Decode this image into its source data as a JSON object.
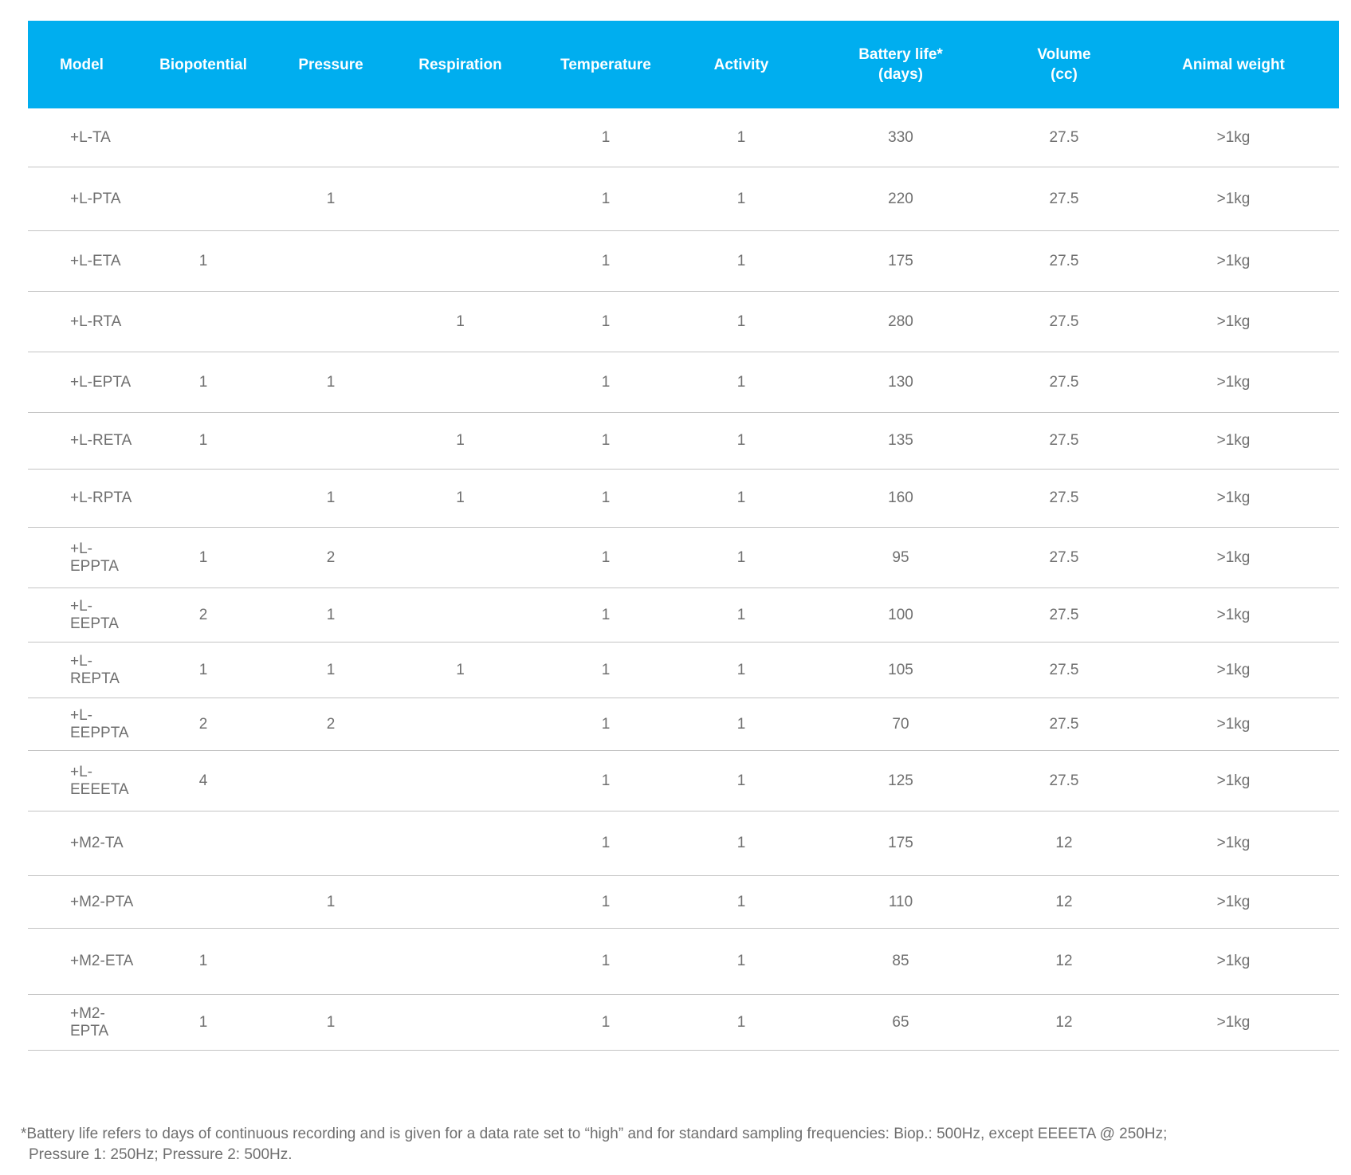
{
  "columns": [
    "Model",
    "Biopotential",
    "Pressure",
    "Respiration",
    "Temperature",
    "Activity",
    "Battery life*\n(days)",
    "Volume\n(cc)",
    "Animal weight"
  ],
  "rows": [
    [
      "+L-TA",
      "",
      "",
      "",
      "1",
      "1",
      "330",
      "27.5",
      ">1kg"
    ],
    [
      "+L-PTA",
      "",
      "1",
      "",
      "1",
      "1",
      "220",
      "27.5",
      ">1kg"
    ],
    [
      "+L-ETA",
      "1",
      "",
      "",
      "1",
      "1",
      "175",
      "27.5",
      ">1kg"
    ],
    [
      "+L-RTA",
      "",
      "",
      "1",
      "1",
      "1",
      "280",
      "27.5",
      ">1kg"
    ],
    [
      "+L-EPTA",
      "1",
      "1",
      "",
      "1",
      "1",
      "130",
      "27.5",
      ">1kg"
    ],
    [
      "+L-RETA",
      "1",
      "",
      "1",
      "1",
      "1",
      "135",
      "27.5",
      ">1kg"
    ],
    [
      "+L-RPTA",
      "",
      "1",
      "1",
      "1",
      "1",
      "160",
      "27.5",
      ">1kg"
    ],
    [
      "+L-EPPTA",
      "1",
      "2",
      "",
      "1",
      "1",
      "95",
      "27.5",
      ">1kg"
    ],
    [
      "+L-EEPTA",
      "2",
      "1",
      "",
      "1",
      "1",
      "100",
      "27.5",
      ">1kg"
    ],
    [
      "+L-REPTA",
      "1",
      "1",
      "1",
      "1",
      "1",
      "105",
      "27.5",
      ">1kg"
    ],
    [
      "+L-EEPPTA",
      "2",
      "2",
      "",
      "1",
      "1",
      "70",
      "27.5",
      ">1kg"
    ],
    [
      "+L-EEEETA",
      "4",
      "",
      "",
      "1",
      "1",
      "125",
      "27.5",
      ">1kg"
    ],
    [
      "+M2-TA",
      "",
      "",
      "",
      "1",
      "1",
      "175",
      "12",
      ">1kg"
    ],
    [
      "+M2-PTA",
      "",
      "1",
      "",
      "1",
      "1",
      "110",
      "12",
      ">1kg"
    ],
    [
      "+M2-ETA",
      "1",
      "",
      "",
      "1",
      "1",
      "85",
      "12",
      ">1kg"
    ],
    [
      "+M2-EPTA",
      "1",
      "1",
      "",
      "1",
      "1",
      "65",
      "12",
      ">1kg"
    ]
  ],
  "footnote": {
    "line1": "*Battery life refers to days of continuous recording and is given for a data rate set to “high” and for standard sampling frequencies: Biop.: 500Hz, except EEEETA @ 250Hz;",
    "line2": "Pressure 1: 250Hz; Pressure 2: 500Hz."
  },
  "colors": {
    "header_bg": "#00aeef",
    "header_text": "#ffffff",
    "body_text": "#6f6f6f",
    "rule": "#c4c4c4"
  }
}
